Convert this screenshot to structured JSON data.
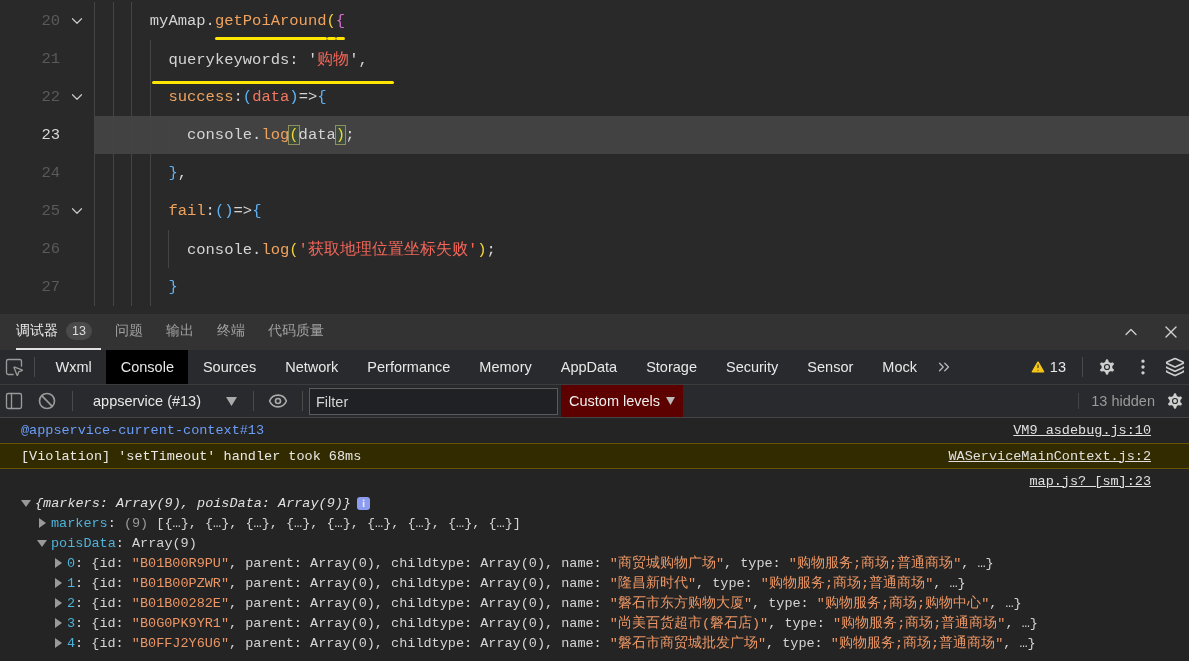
{
  "editor": {
    "lines": [
      {
        "number": "20",
        "expanded": true,
        "current": false,
        "underlined": false,
        "tokens": [
          {
            "text": "myAmap.",
            "kind": "plain",
            "underlined": false
          },
          {
            "text": "getPoiAround",
            "kind": "method",
            "underlined": true
          },
          {
            "text": "(",
            "kind": "gold",
            "underlined": true
          },
          {
            "text": "{",
            "kind": "pink",
            "underlined": true
          }
        ],
        "children": [
          {
            "number": "21",
            "current": false,
            "underlined": true,
            "tokens": [
              {
                "text": "querykeywords: '",
                "kind": "plain"
              },
              {
                "text": "购物",
                "kind": "string"
              },
              {
                "text": "',",
                "kind": "plain"
              }
            ]
          },
          {
            "number": "22",
            "expanded": true,
            "current": false,
            "underlined": false,
            "tokens": [
              {
                "text": "success",
                "kind": "method"
              },
              {
                "text": ":",
                "kind": "plain"
              },
              {
                "text": "(",
                "kind": "blue"
              },
              {
                "text": "data",
                "kind": "param"
              },
              {
                "text": ")",
                "kind": "blue"
              },
              {
                "text": "=>",
                "kind": "plain"
              },
              {
                "text": "{",
                "kind": "blue"
              }
            ],
            "children": [
              {
                "number": "23",
                "current": true,
                "underlined": false,
                "tokens": [
                  {
                    "text": "console.",
                    "kind": "plain",
                    "matched": false
                  },
                  {
                    "text": "log",
                    "kind": "method",
                    "matched": false
                  },
                  {
                    "text": "(",
                    "kind": "gold",
                    "matched": true
                  },
                  {
                    "text": "data",
                    "kind": "plain",
                    "matched": false
                  },
                  {
                    "text": ")",
                    "kind": "gold",
                    "matched": true
                  },
                  {
                    "text": ";",
                    "kind": "plain",
                    "matched": false
                  }
                ]
              }
            ]
          },
          {
            "number": "24",
            "current": false,
            "underlined": false,
            "tokens": [
              {
                "text": "}",
                "kind": "blue"
              },
              {
                "text": ",",
                "kind": "plain"
              }
            ]
          },
          {
            "number": "25",
            "expanded": true,
            "current": false,
            "underlined": false,
            "tokens": [
              {
                "text": "fail",
                "kind": "method"
              },
              {
                "text": ":",
                "kind": "plain"
              },
              {
                "text": "()",
                "kind": "blue"
              },
              {
                "text": "=>",
                "kind": "plain"
              },
              {
                "text": "{",
                "kind": "blue"
              }
            ],
            "children": [
              {
                "number": "26",
                "current": false,
                "underlined": false,
                "tokens": [
                  {
                    "text": "console.",
                    "kind": "plain"
                  },
                  {
                    "text": "log",
                    "kind": "method"
                  },
                  {
                    "text": "(",
                    "kind": "gold"
                  },
                  {
                    "text": "'获取地理位置坐标失败'",
                    "kind": "string"
                  },
                  {
                    "text": ")",
                    "kind": "gold"
                  },
                  {
                    "text": ";",
                    "kind": "plain"
                  }
                ]
              }
            ]
          },
          {
            "number": "27",
            "current": false,
            "underlined": false,
            "tokens": [
              {
                "text": "}",
                "kind": "blue"
              }
            ]
          }
        ]
      }
    ]
  },
  "panel_tabs": [
    {
      "label": "调试器",
      "selected": true,
      "badge": "13"
    },
    {
      "label": "问题",
      "selected": false
    },
    {
      "label": "输出",
      "selected": false
    },
    {
      "label": "终端",
      "selected": false
    },
    {
      "label": "代码质量",
      "selected": false
    }
  ],
  "devtools_tabs": [
    {
      "label": "Wxml",
      "selected": false
    },
    {
      "label": "Console",
      "selected": true
    },
    {
      "label": "Sources",
      "selected": false
    },
    {
      "label": "Network",
      "selected": false
    },
    {
      "label": "Performance",
      "selected": false
    },
    {
      "label": "Memory",
      "selected": false
    },
    {
      "label": "AppData",
      "selected": false
    },
    {
      "label": "Storage",
      "selected": false
    },
    {
      "label": "Security",
      "selected": false
    },
    {
      "label": "Sensor",
      "selected": false
    },
    {
      "label": "Mock",
      "selected": false
    }
  ],
  "warning_count": "13",
  "toolbar": {
    "context": "appservice (#13)",
    "filter": {
      "placeholder": "Filter"
    },
    "levels": "Custom levels",
    "hidden": "13 hidden"
  },
  "console": [
    {
      "kind": "context",
      "text": "@appservice-current-context#13",
      "source": "VM9 asdebug.js:10"
    },
    {
      "kind": "violation",
      "text": "[Violation] 'setTimeout' handler took 68ms",
      "source": "WAServiceMainContext.js:2"
    },
    {
      "kind": "log",
      "source": "map.js? [sm]:23",
      "object": {
        "expanded": true,
        "tokens": [
          {
            "text": "{markers: Array(9), poisData: Array(9)}",
            "kind": "italic"
          }
        ],
        "children": [
          {
            "expanded": false,
            "tokens": [
              {
                "text": "markers",
                "kind": "key"
              },
              {
                "text": ": ",
                "kind": "punct"
              },
              {
                "text": "(9) ",
                "kind": "dim"
              },
              {
                "text": "[{…}, {…}, {…}, {…}, {…}, {…}, {…}, {…}, {…}]",
                "kind": "punct"
              }
            ]
          },
          {
            "expanded": true,
            "tokens": [
              {
                "text": "poisData",
                "kind": "key"
              },
              {
                "text": ": Array(9)",
                "kind": "punct"
              }
            ],
            "children": [
              {
                "expanded": false,
                "tokens": [
                  {
                    "text": "0",
                    "kind": "key"
                  },
                  {
                    "text": ": {id: ",
                    "kind": "punct"
                  },
                  {
                    "text": "\"B01B00R9PU\"",
                    "kind": "string"
                  },
                  {
                    "text": ", parent: Array(0), childtype: Array(0), name: ",
                    "kind": "punct"
                  },
                  {
                    "text": "\"商贸城购物广场\"",
                    "kind": "string"
                  },
                  {
                    "text": ", type: ",
                    "kind": "punct"
                  },
                  {
                    "text": "\"购物服务;商场;普通商场\"",
                    "kind": "string"
                  },
                  {
                    "text": ", …}",
                    "kind": "punct"
                  }
                ]
              },
              {
                "expanded": false,
                "tokens": [
                  {
                    "text": "1",
                    "kind": "key"
                  },
                  {
                    "text": ": {id: ",
                    "kind": "punct"
                  },
                  {
                    "text": "\"B01B00PZWR\"",
                    "kind": "string"
                  },
                  {
                    "text": ", parent: Array(0), childtype: Array(0), name: ",
                    "kind": "punct"
                  },
                  {
                    "text": "\"隆昌新时代\"",
                    "kind": "string"
                  },
                  {
                    "text": ", type: ",
                    "kind": "punct"
                  },
                  {
                    "text": "\"购物服务;商场;普通商场\"",
                    "kind": "string"
                  },
                  {
                    "text": ", …}",
                    "kind": "punct"
                  }
                ]
              },
              {
                "expanded": false,
                "tokens": [
                  {
                    "text": "2",
                    "kind": "key"
                  },
                  {
                    "text": ": {id: ",
                    "kind": "punct"
                  },
                  {
                    "text": "\"B01B00282E\"",
                    "kind": "string"
                  },
                  {
                    "text": ", parent: Array(0), childtype: Array(0), name: ",
                    "kind": "punct"
                  },
                  {
                    "text": "\"磐石市东方购物大厦\"",
                    "kind": "string"
                  },
                  {
                    "text": ", type: ",
                    "kind": "punct"
                  },
                  {
                    "text": "\"购物服务;商场;购物中心\"",
                    "kind": "string"
                  },
                  {
                    "text": ", …}",
                    "kind": "punct"
                  }
                ]
              },
              {
                "expanded": false,
                "tokens": [
                  {
                    "text": "3",
                    "kind": "key"
                  },
                  {
                    "text": ": {id: ",
                    "kind": "punct"
                  },
                  {
                    "text": "\"B0G0PK9YR1\"",
                    "kind": "string"
                  },
                  {
                    "text": ", parent: Array(0), childtype: Array(0), name: ",
                    "kind": "punct"
                  },
                  {
                    "text": "\"尚美百货超市(磐石店)\"",
                    "kind": "string"
                  },
                  {
                    "text": ", type: ",
                    "kind": "punct"
                  },
                  {
                    "text": "\"购物服务;商场;普通商场\"",
                    "kind": "string"
                  },
                  {
                    "text": ", …}",
                    "kind": "punct"
                  }
                ]
              },
              {
                "expanded": false,
                "tokens": [
                  {
                    "text": "4",
                    "kind": "key"
                  },
                  {
                    "text": ": {id: ",
                    "kind": "punct"
                  },
                  {
                    "text": "\"B0FFJ2Y6U6\"",
                    "kind": "string"
                  },
                  {
                    "text": ", parent: Array(0), childtype: Array(0), name: ",
                    "kind": "punct"
                  },
                  {
                    "text": "\"磐石市商贸城批发广场\"",
                    "kind": "string"
                  },
                  {
                    "text": ", type: ",
                    "kind": "punct"
                  },
                  {
                    "text": "\"购物服务;商场;普通商场\"",
                    "kind": "string"
                  },
                  {
                    "text": ", …}",
                    "kind": "punct"
                  }
                ]
              }
            ]
          }
        ]
      }
    }
  ]
}
